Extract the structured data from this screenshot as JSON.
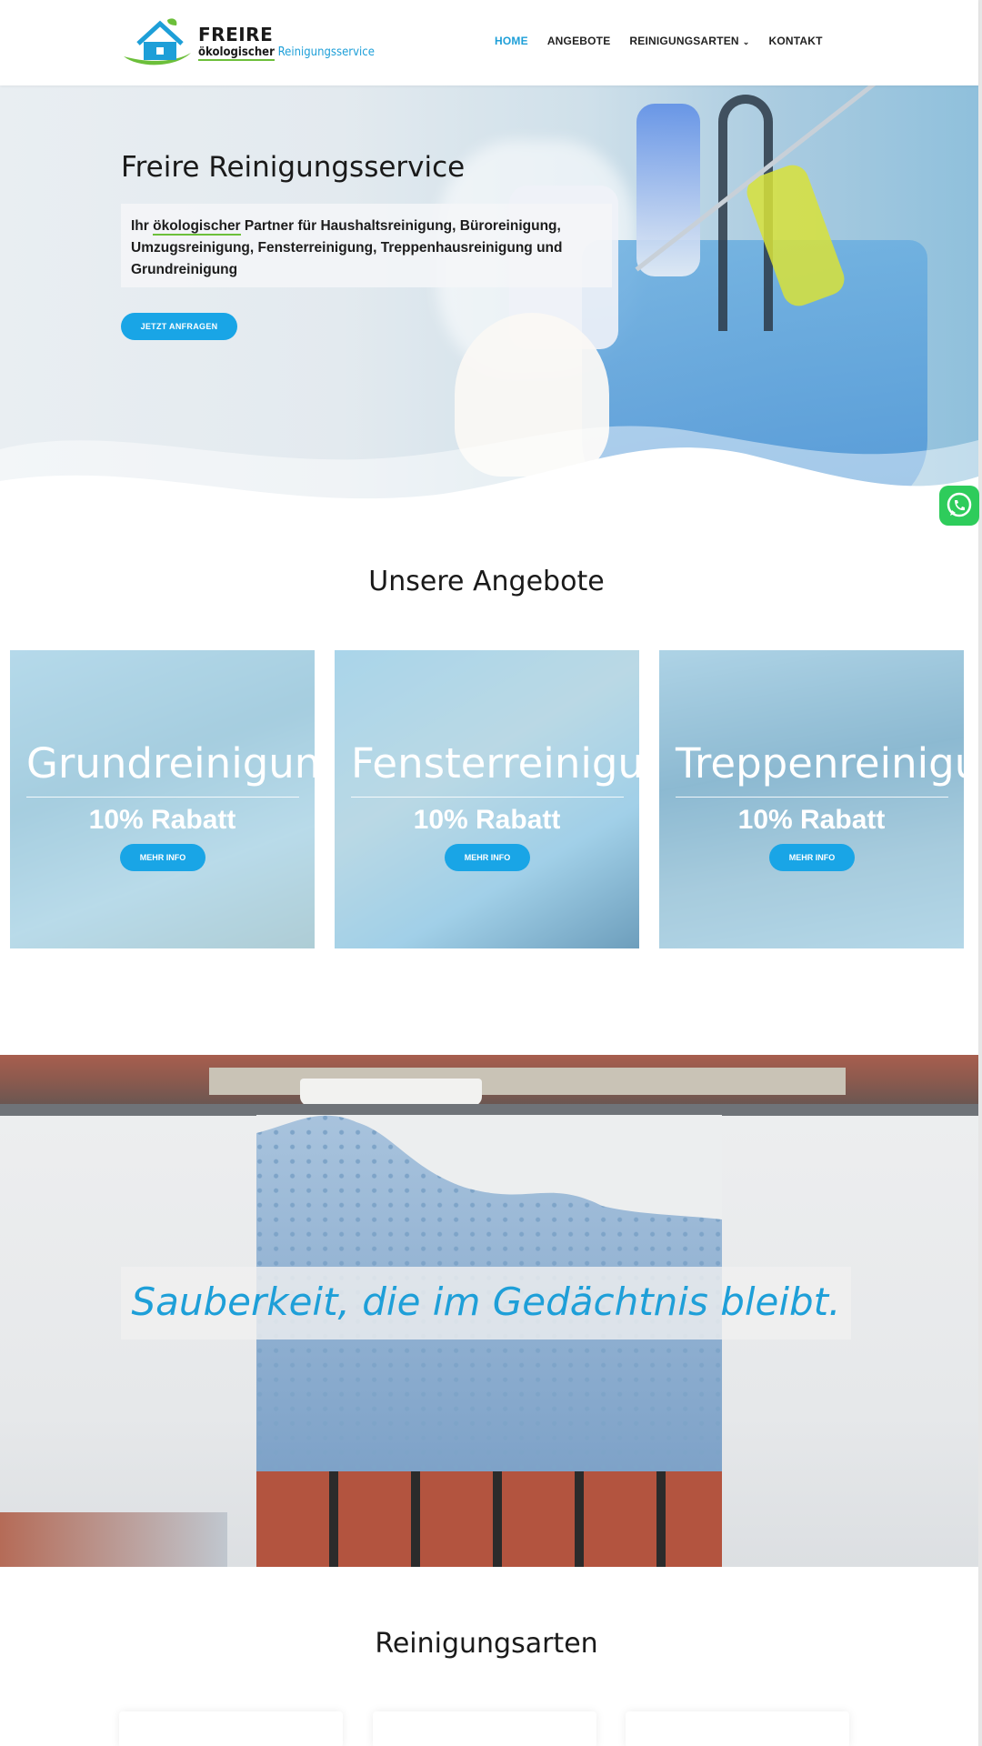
{
  "header": {
    "logo_title": "FREIRE",
    "logo_sub_eco": "ökologischer",
    "logo_sub_service": "Reinigungsservice",
    "nav": [
      {
        "label": "HOME",
        "active": true
      },
      {
        "label": "ANGEBOTE",
        "active": false
      },
      {
        "label": "REINIGUNGSARTEN",
        "active": false,
        "dropdown": true
      },
      {
        "label": "KONTAKT",
        "active": false
      }
    ]
  },
  "hero": {
    "title": "Freire Reinigungsservice",
    "text_prefix": "Ihr",
    "text_eco": "ökologischer",
    "text_rest": " Partner für Haushaltsreinigung, Büroreinigung, Umzugsreinigung, Fensterreinigung, Treppenhausreinigung und Grundreinigung",
    "cta_label": "JETZT ANFRAGEN"
  },
  "whatsapp": {
    "icon": "whatsapp-icon",
    "color": "#2ecc5b"
  },
  "offers": {
    "title": "Unsere Angebote",
    "cards": [
      {
        "name": "Grundreinigung",
        "discount": "10% Rabatt",
        "button": "MEHR INFO"
      },
      {
        "name": "Fensterreinigung",
        "discount": "10% Rabatt",
        "button": "MEHR INFO"
      },
      {
        "name": "Treppenreinigung",
        "discount": "10% Rabatt",
        "button": "MEHR INFO"
      }
    ]
  },
  "banner": {
    "quote": "Sauberkeit, die im Gedächtnis bleibt."
  },
  "types": {
    "title": "Reinigungsarten"
  },
  "colors": {
    "accent": "#19a5e6",
    "logo_blue": "#1e9fd8",
    "logo_green": "#6cbf3a"
  }
}
